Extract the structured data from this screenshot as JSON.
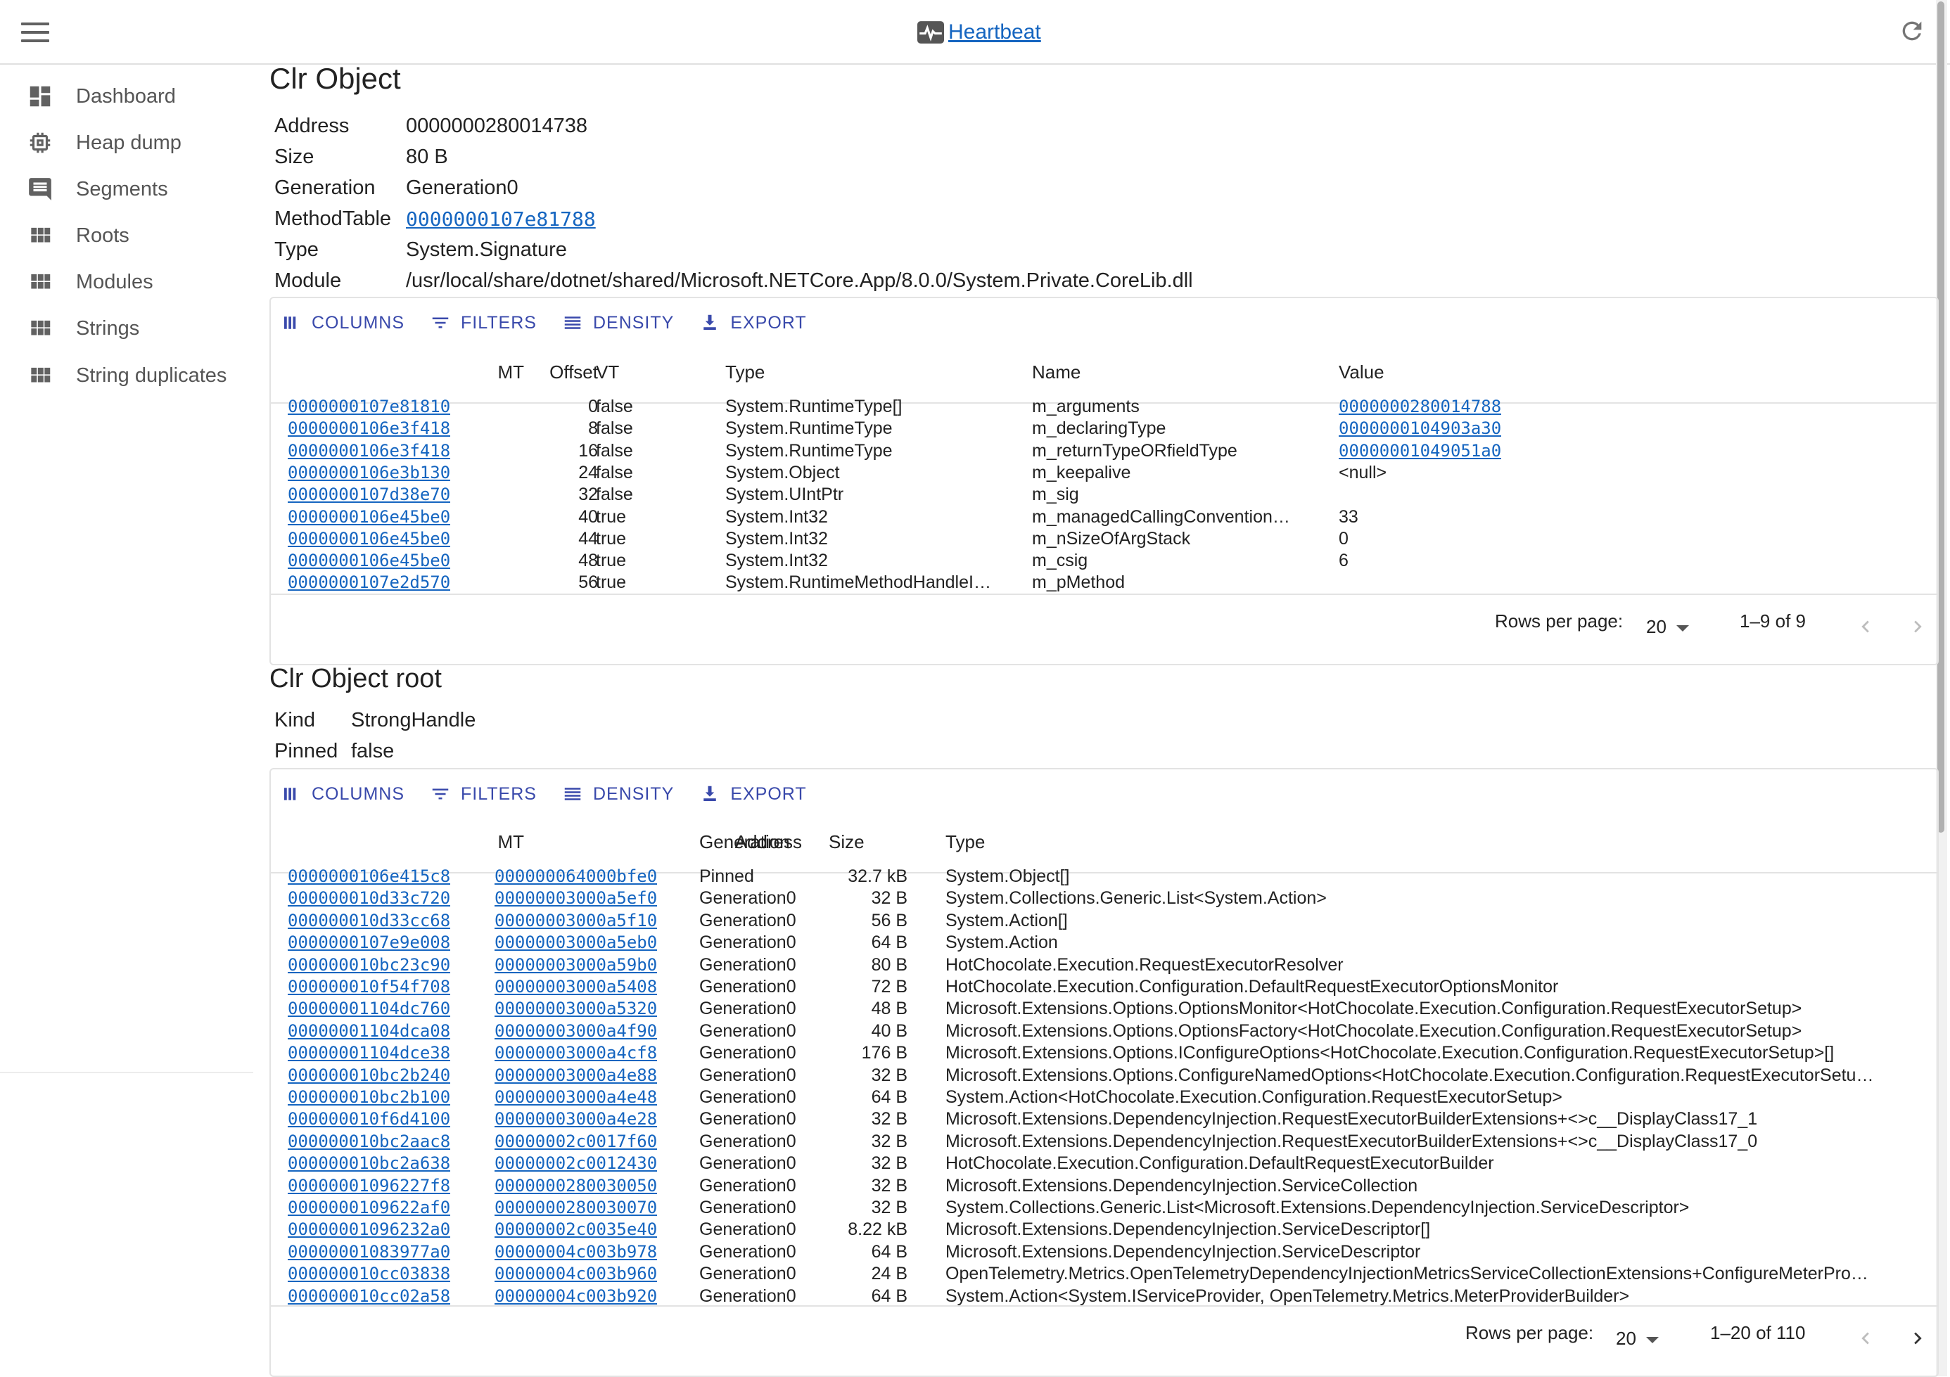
{
  "appbar": {
    "title": "Heartbeat"
  },
  "sidebar": {
    "items": [
      {
        "label": "Dashboard",
        "icon": "dashboard-icon"
      },
      {
        "label": "Heap dump",
        "icon": "memory-icon"
      },
      {
        "label": "Segments",
        "icon": "comment-icon"
      },
      {
        "label": "Roots",
        "icon": "grid-icon"
      },
      {
        "label": "Modules",
        "icon": "grid-icon"
      },
      {
        "label": "Strings",
        "icon": "grid-icon"
      },
      {
        "label": "String duplicates",
        "icon": "grid-icon"
      }
    ]
  },
  "object": {
    "title": "Clr Object",
    "props": [
      {
        "label": "Address",
        "value": "0000000280014738"
      },
      {
        "label": "Size",
        "value": "80 B"
      },
      {
        "label": "Generation",
        "value": "Generation0"
      },
      {
        "label": "MethodTable",
        "value": "0000000107e81788"
      },
      {
        "label": "Type",
        "value": "System.Signature"
      },
      {
        "label": "Module",
        "value": "/usr/local/share/dotnet/shared/Microsoft.NETCore.App/8.0.0/System.Private.CoreLib.dll"
      }
    ]
  },
  "toolbar": {
    "columns": "COLUMNS",
    "filters": "FILTERS",
    "density": "DENSITY",
    "export": "EXPORT"
  },
  "fields_grid": {
    "headers": {
      "mt": "MT",
      "offset": "Offset",
      "vt": "VT",
      "type": "Type",
      "name": "Name",
      "value": "Value"
    },
    "rows": [
      {
        "mt": "0000000107e81810",
        "offset": "0",
        "vt": "false",
        "type": "System.RuntimeType[]",
        "name": "m_arguments",
        "value": "0000000280014788",
        "value_link": true
      },
      {
        "mt": "0000000106e3f418",
        "offset": "8",
        "vt": "false",
        "type": "System.RuntimeType",
        "name": "m_declaringType",
        "value": "0000000104903a30",
        "value_link": true
      },
      {
        "mt": "0000000106e3f418",
        "offset": "16",
        "vt": "false",
        "type": "System.RuntimeType",
        "name": "m_returnTypeORfieldType",
        "value": "00000001049051a0",
        "value_link": true
      },
      {
        "mt": "0000000106e3b130",
        "offset": "24",
        "vt": "false",
        "type": "System.Object",
        "name": "m_keepalive",
        "value": "<null>",
        "value_link": false
      },
      {
        "mt": "0000000107d38e70",
        "offset": "32",
        "vt": "false",
        "type": "System.UIntPtr",
        "name": "m_sig",
        "value": "",
        "value_link": false
      },
      {
        "mt": "0000000106e45be0",
        "offset": "40",
        "vt": "true",
        "type": "System.Int32",
        "name": "m_managedCallingConvention…",
        "value": "33",
        "value_link": false
      },
      {
        "mt": "0000000106e45be0",
        "offset": "44",
        "vt": "true",
        "type": "System.Int32",
        "name": "m_nSizeOfArgStack",
        "value": "0",
        "value_link": false
      },
      {
        "mt": "0000000106e45be0",
        "offset": "48",
        "vt": "true",
        "type": "System.Int32",
        "name": "m_csig",
        "value": "6",
        "value_link": false
      },
      {
        "mt": "0000000107e2d570",
        "offset": "56",
        "vt": "true",
        "type": "System.RuntimeMethodHandleI…",
        "name": "m_pMethod",
        "value": "",
        "value_link": false
      }
    ],
    "rows_per_page_label": "Rows per page:",
    "rows_per_page": "20",
    "range": "1–9 of 9"
  },
  "root": {
    "title": "Clr Object root",
    "props": [
      {
        "label": "Kind",
        "value": "StrongHandle"
      },
      {
        "label": "Pinned",
        "value": "false"
      }
    ]
  },
  "root_grid": {
    "headers": {
      "mt": "MT",
      "address": "Address",
      "generation": "Generation",
      "size": "Size",
      "type": "Type"
    },
    "rows": [
      {
        "mt": "0000000106e415c8",
        "address": "000000064000bfe0",
        "generation": "Pinned",
        "size": "32.7 kB",
        "type": "System.Object[]"
      },
      {
        "mt": "000000010d33c720",
        "address": "00000003000a5ef0",
        "generation": "Generation0",
        "size": "32 B",
        "type": "System.Collections.Generic.List<System.Action>"
      },
      {
        "mt": "000000010d33cc68",
        "address": "00000003000a5f10",
        "generation": "Generation0",
        "size": "56 B",
        "type": "System.Action[]"
      },
      {
        "mt": "0000000107e9e008",
        "address": "00000003000a5eb0",
        "generation": "Generation0",
        "size": "64 B",
        "type": "System.Action"
      },
      {
        "mt": "000000010bc23c90",
        "address": "00000003000a59b0",
        "generation": "Generation0",
        "size": "80 B",
        "type": "HotChocolate.Execution.RequestExecutorResolver"
      },
      {
        "mt": "000000010f54f708",
        "address": "00000003000a5408",
        "generation": "Generation0",
        "size": "72 B",
        "type": "HotChocolate.Execution.Configuration.DefaultRequestExecutorOptionsMonitor"
      },
      {
        "mt": "00000001104dc760",
        "address": "00000003000a5320",
        "generation": "Generation0",
        "size": "48 B",
        "type": "Microsoft.Extensions.Options.OptionsMonitor<HotChocolate.Execution.Configuration.RequestExecutorSetup>"
      },
      {
        "mt": "00000001104dca08",
        "address": "00000003000a4f90",
        "generation": "Generation0",
        "size": "40 B",
        "type": "Microsoft.Extensions.Options.OptionsFactory<HotChocolate.Execution.Configuration.RequestExecutorSetup>"
      },
      {
        "mt": "00000001104dce38",
        "address": "00000003000a4cf8",
        "generation": "Generation0",
        "size": "176 B",
        "type": "Microsoft.Extensions.Options.IConfigureOptions<HotChocolate.Execution.Configuration.RequestExecutorSetup>[]"
      },
      {
        "mt": "000000010bc2b240",
        "address": "00000003000a4e88",
        "generation": "Generation0",
        "size": "32 B",
        "type": "Microsoft.Extensions.Options.ConfigureNamedOptions<HotChocolate.Execution.Configuration.RequestExecutorSetu…"
      },
      {
        "mt": "000000010bc2b100",
        "address": "00000003000a4e48",
        "generation": "Generation0",
        "size": "64 B",
        "type": "System.Action<HotChocolate.Execution.Configuration.RequestExecutorSetup>"
      },
      {
        "mt": "000000010f6d4100",
        "address": "00000003000a4e28",
        "generation": "Generation0",
        "size": "32 B",
        "type": "Microsoft.Extensions.DependencyInjection.RequestExecutorBuilderExtensions+<>c__DisplayClass17_1"
      },
      {
        "mt": "000000010bc2aac8",
        "address": "00000002c0017f60",
        "generation": "Generation0",
        "size": "32 B",
        "type": "Microsoft.Extensions.DependencyInjection.RequestExecutorBuilderExtensions+<>c__DisplayClass17_0"
      },
      {
        "mt": "000000010bc2a638",
        "address": "00000002c0012430",
        "generation": "Generation0",
        "size": "32 B",
        "type": "HotChocolate.Execution.Configuration.DefaultRequestExecutorBuilder"
      },
      {
        "mt": "00000001096227f8",
        "address": "0000000280030050",
        "generation": "Generation0",
        "size": "32 B",
        "type": "Microsoft.Extensions.DependencyInjection.ServiceCollection"
      },
      {
        "mt": "0000000109622af0",
        "address": "0000000280030070",
        "generation": "Generation0",
        "size": "32 B",
        "type": "System.Collections.Generic.List<Microsoft.Extensions.DependencyInjection.ServiceDescriptor>"
      },
      {
        "mt": "00000001096232a0",
        "address": "00000002c0035e40",
        "generation": "Generation0",
        "size": "8.22 kB",
        "type": "Microsoft.Extensions.DependencyInjection.ServiceDescriptor[]"
      },
      {
        "mt": "00000001083977a0",
        "address": "00000004c003b978",
        "generation": "Generation0",
        "size": "64 B",
        "type": "Microsoft.Extensions.DependencyInjection.ServiceDescriptor"
      },
      {
        "mt": "000000010cc03838",
        "address": "00000004c003b960",
        "generation": "Generation0",
        "size": "24 B",
        "type": "OpenTelemetry.Metrics.OpenTelemetryDependencyInjectionMetricsServiceCollectionExtensions+ConfigureMeterPro…"
      },
      {
        "mt": "000000010cc02a58",
        "address": "00000004c003b920",
        "generation": "Generation0",
        "size": "64 B",
        "type": "System.Action<System.IServiceProvider, OpenTelemetry.Metrics.MeterProviderBuilder>"
      }
    ],
    "rows_per_page_label": "Rows per page:",
    "rows_per_page": "20",
    "range": "1–20 of 110"
  }
}
